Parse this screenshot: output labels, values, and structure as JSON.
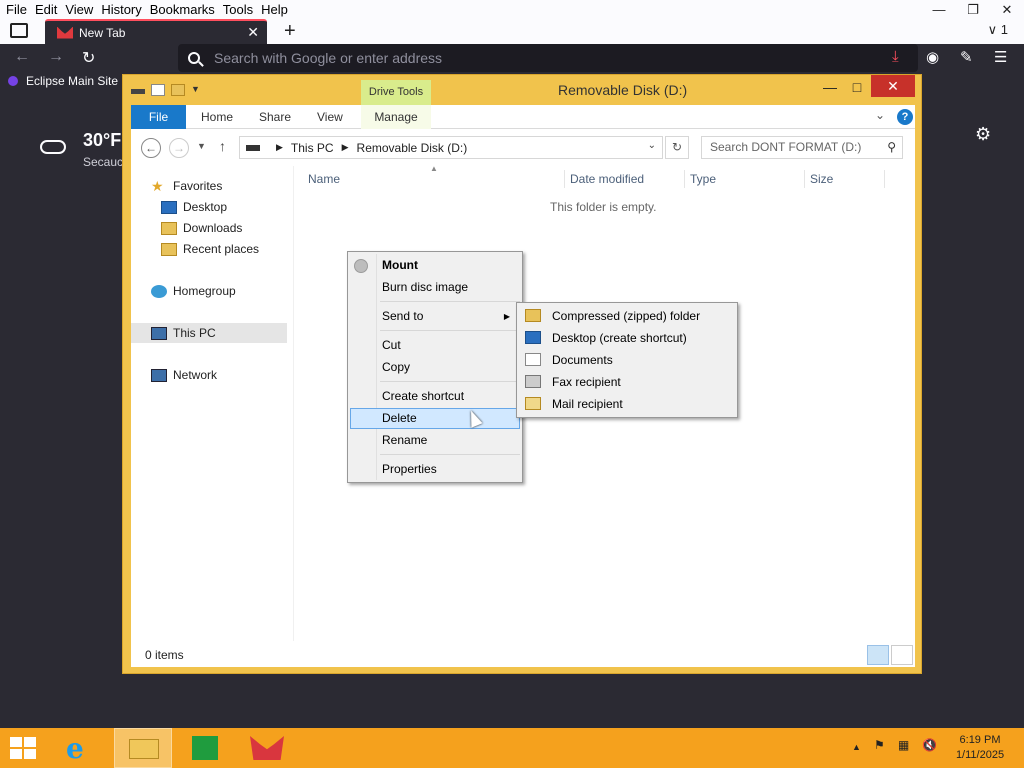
{
  "browser": {
    "menus": [
      "File",
      "Edit",
      "View",
      "History",
      "Bookmarks",
      "Tools",
      "Help"
    ],
    "tab_title": "New Tab",
    "url_placeholder": "Search with Google or enter address",
    "bookmark": "Eclipse Main Site",
    "tab_overflow": "∨ 1"
  },
  "weather": {
    "temp": "30°F",
    "city": "Secaucus"
  },
  "explorer": {
    "title": "Removable Disk (D:)",
    "context_tab": "Drive Tools",
    "ribbon_tabs": [
      "File",
      "Home",
      "Share",
      "View",
      "Manage"
    ],
    "breadcrumb": [
      "This PC",
      "Removable Disk (D:)"
    ],
    "search_placeholder": "Search DONT FORMAT (D:)",
    "nav": {
      "favorites": "Favorites",
      "desktop": "Desktop",
      "downloads": "Downloads",
      "recent": "Recent places",
      "homegroup": "Homegroup",
      "thispc": "This PC",
      "network": "Network"
    },
    "columns": [
      "Name",
      "Date modified",
      "Type",
      "Size"
    ],
    "empty_message": "This folder is empty.",
    "status": "0 items"
  },
  "context_menu": {
    "items": [
      "Mount",
      "Burn disc image",
      "Send to",
      "Cut",
      "Copy",
      "Create shortcut",
      "Delete",
      "Rename",
      "Properties"
    ],
    "highlighted": "Delete"
  },
  "send_to": [
    "Compressed (zipped) folder",
    "Desktop (create shortcut)",
    "Documents",
    "Fax recipient",
    "Mail recipient"
  ],
  "taskbar": {
    "time": "6:19 PM",
    "date": "1/11/2025",
    "accent": "#f5a11d"
  },
  "colors": {
    "file_tab": "#1979ca",
    "window_frame": "#f1c34c",
    "close": "#c7312a",
    "highlight": "#d1e8ff"
  }
}
